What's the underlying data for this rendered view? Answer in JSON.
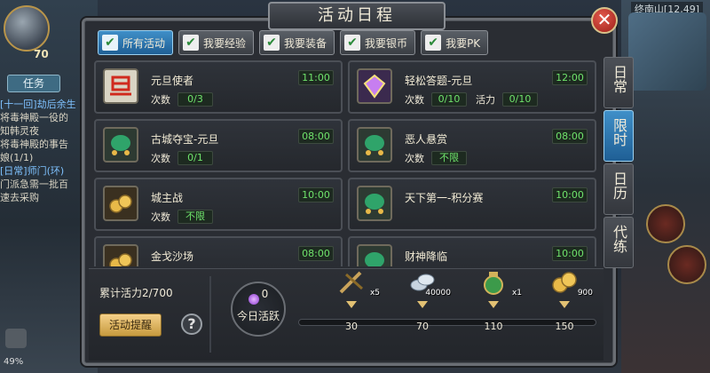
{
  "window": {
    "title": "活动日程",
    "close_symbol": "✕"
  },
  "background": {
    "level": "70",
    "task_button": "任务",
    "minimap_label": "终南山[12,49]",
    "battery": "49%",
    "chat_lines": [
      "[十一回]劫后余生",
      "将毒神殿一役的",
      "知韩灵夜",
      "将毒神殿的事告",
      "娘(1/1)",
      "[日常]师门(环)",
      "门派急需一批百",
      "速去采购"
    ]
  },
  "filter_tabs": [
    {
      "label": "所有活动",
      "active": true
    },
    {
      "label": "我要经验",
      "active": false
    },
    {
      "label": "我要装备",
      "active": false
    },
    {
      "label": "我要银币",
      "active": false
    },
    {
      "label": "我要PK",
      "active": false
    }
  ],
  "side_tabs": [
    {
      "label": "日常",
      "active": false
    },
    {
      "label": "限时",
      "active": true
    },
    {
      "label": "日历",
      "active": false
    },
    {
      "label": "代练",
      "active": false
    }
  ],
  "activities": [
    {
      "name": "元旦使者",
      "time": "11:00",
      "icon": "new-year-icon",
      "stats": [
        {
          "label": "次数",
          "value": "0/3"
        }
      ]
    },
    {
      "name": "轻松答题-元旦",
      "time": "12:00",
      "icon": "crystal-gift-icon",
      "stats": [
        {
          "label": "次数",
          "value": "0/10"
        },
        {
          "label": "活力",
          "value": "0/10"
        }
      ]
    },
    {
      "name": "古城夺宝-元旦",
      "time": "08:00",
      "icon": "jade-treasure-icon",
      "stats": [
        {
          "label": "次数",
          "value": "0/1"
        }
      ]
    },
    {
      "name": "恶人悬赏",
      "time": "08:00",
      "icon": "jade-treasure-icon",
      "stats": [
        {
          "label": "次数",
          "value": "不限"
        }
      ]
    },
    {
      "name": "城主战",
      "time": "10:00",
      "icon": "gold-coins-icon",
      "stats": [
        {
          "label": "次数",
          "value": "不限"
        }
      ]
    },
    {
      "name": "天下第一-积分赛",
      "time": "10:00",
      "icon": "jade-treasure-icon",
      "stats": []
    },
    {
      "name": "金戈沙场",
      "time": "08:00",
      "icon": "gold-coins-icon",
      "stats": []
    },
    {
      "name": "财神降临",
      "time": "10:00",
      "icon": "jade-treasure-icon",
      "stats": []
    }
  ],
  "vitality": {
    "label": "累计活力2/700",
    "remind_button": "活动提醒",
    "help_symbol": "?"
  },
  "today": {
    "value": "0",
    "label": "今日活跃"
  },
  "milestones": [
    {
      "value": "30",
      "reward_icon": "fan-scroll-icon",
      "qty": "x5"
    },
    {
      "value": "70",
      "reward_icon": "silver-coins-icon",
      "qty": "40000"
    },
    {
      "value": "110",
      "reward_icon": "treasure-pouch-icon",
      "qty": "x1"
    },
    {
      "value": "150",
      "reward_icon": "gold-coins-icon",
      "qty": "900"
    }
  ]
}
